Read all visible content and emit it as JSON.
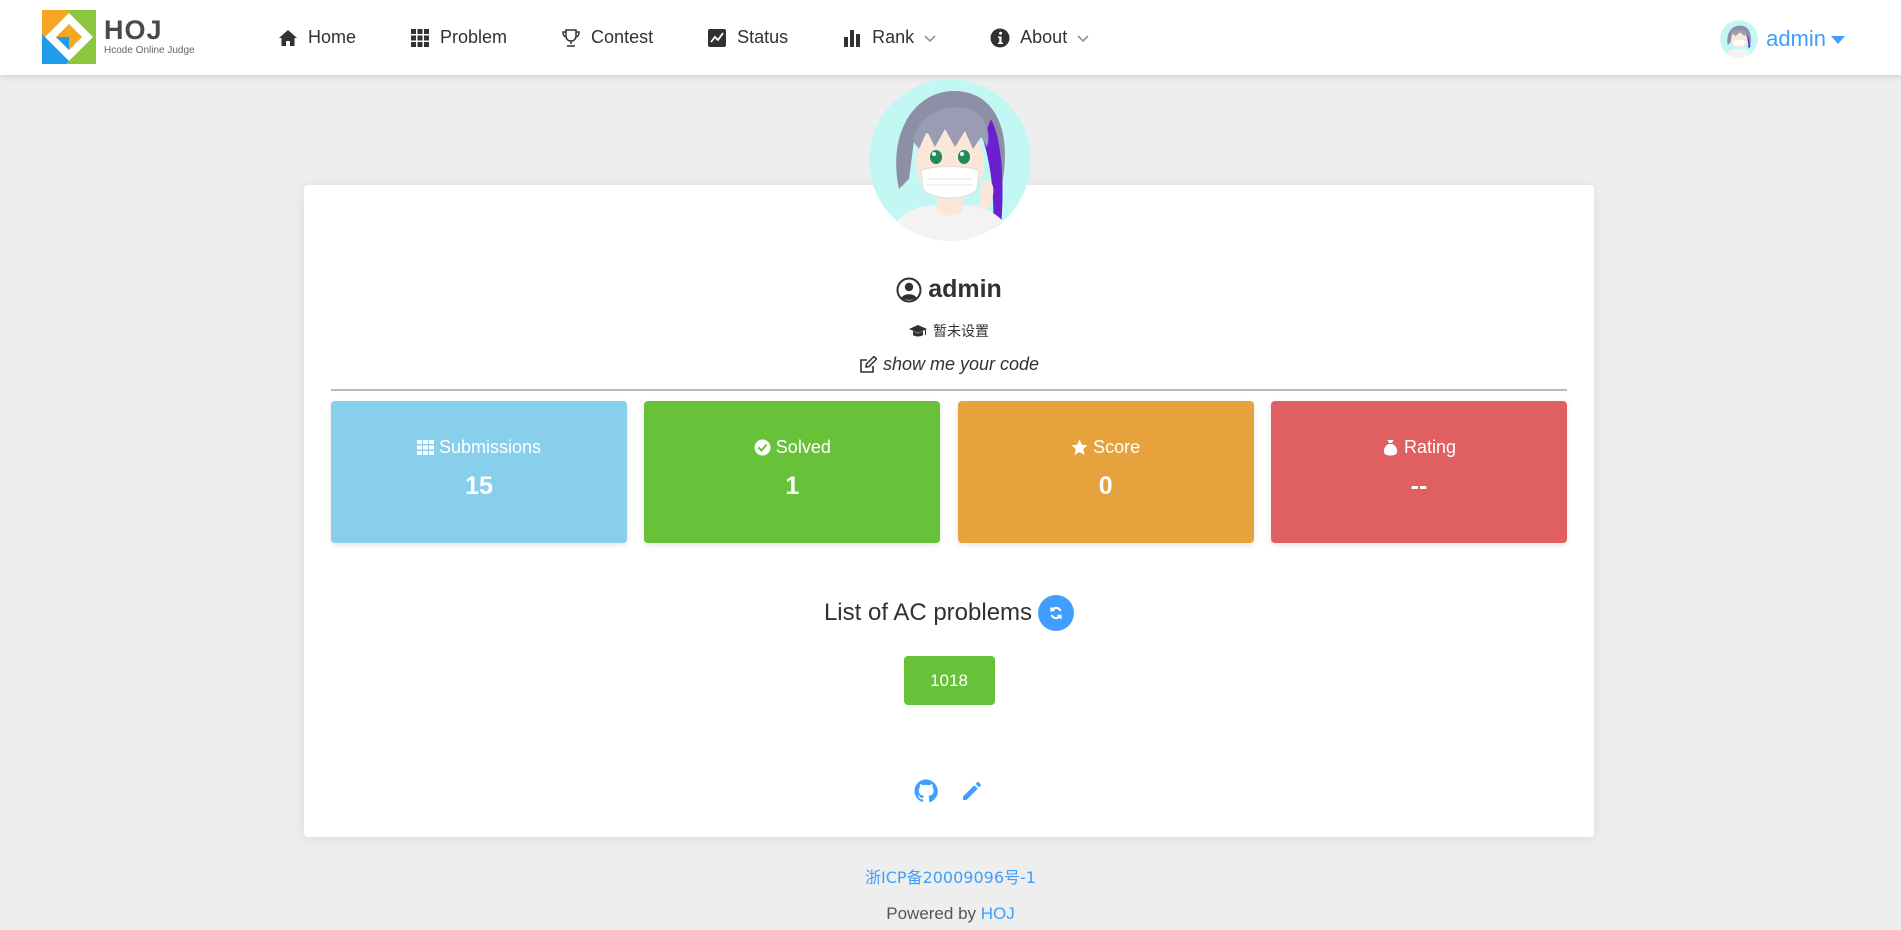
{
  "colors": {
    "accent": "#409eff",
    "submissions": "#88cfec",
    "solved": "#67c23a",
    "score": "#e6a23c",
    "rating": "#e06061",
    "ac_problem": "#67c23a",
    "refresh": "#409eff",
    "link_icon": "#409eff"
  },
  "header": {
    "logo": {
      "title": "HOJ",
      "subtitle": "Hcode Online Judge",
      "icon": "hoj-logo-icon"
    },
    "nav": [
      {
        "label": "Home",
        "icon": "home-icon",
        "dropdown": false
      },
      {
        "label": "Problem",
        "icon": "grid-icon",
        "dropdown": false
      },
      {
        "label": "Contest",
        "icon": "trophy-icon",
        "dropdown": false
      },
      {
        "label": "Status",
        "icon": "chart-line-icon",
        "dropdown": false
      },
      {
        "label": "Rank",
        "icon": "bar-chart-icon",
        "dropdown": true
      },
      {
        "label": "About",
        "icon": "info-icon",
        "dropdown": true
      }
    ],
    "user": {
      "name": "admin",
      "icon": "avatar"
    }
  },
  "profile": {
    "username": "admin",
    "school": "暂未设置",
    "signature": "show me your code",
    "stats": [
      {
        "label": "Submissions",
        "value": "15",
        "icon": "grid-icon",
        "color_key": "submissions"
      },
      {
        "label": "Solved",
        "value": "1",
        "icon": "check-circle-icon",
        "color_key": "solved"
      },
      {
        "label": "Score",
        "value": "0",
        "icon": "star-icon",
        "color_key": "score"
      },
      {
        "label": "Rating",
        "value": "--",
        "icon": "money-bag-icon",
        "color_key": "rating"
      }
    ],
    "ac_title": "List of AC problems",
    "ac_problems": [
      "1018"
    ],
    "links": [
      {
        "icon": "github-icon"
      },
      {
        "icon": "pencil-icon"
      }
    ]
  },
  "footer": {
    "icp": "浙ICP备20009096号-1",
    "powered_prefix": "Powered by ",
    "powered_link": "HOJ"
  }
}
